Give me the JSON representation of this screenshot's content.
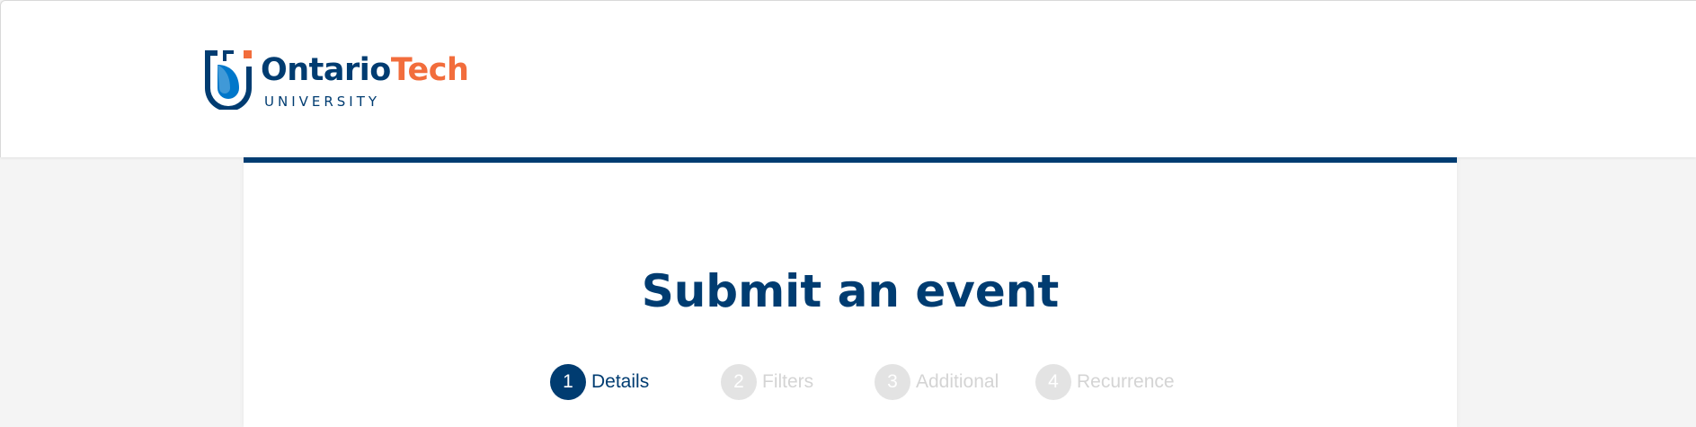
{
  "header": {
    "logo": {
      "word_primary": "Ontario",
      "word_accent": "Tech",
      "subtitle": "UNIVERSITY",
      "colors": {
        "primary": "#003c71",
        "accent": "#f26d3c",
        "mark_light": "#0077ca"
      }
    }
  },
  "main": {
    "title": "Submit an event",
    "steps": [
      {
        "number": "1",
        "label": "Details",
        "active": true
      },
      {
        "number": "2",
        "label": "Filters",
        "active": false
      },
      {
        "number": "3",
        "label": "Additional",
        "active": false
      },
      {
        "number": "4",
        "label": "Recurrence",
        "active": false
      }
    ]
  },
  "colors": {
    "brand": "#003c71",
    "step_inactive": "#e3e3e3",
    "step_inactive_text": "#d4d4d4",
    "background": "#f4f4f4"
  }
}
